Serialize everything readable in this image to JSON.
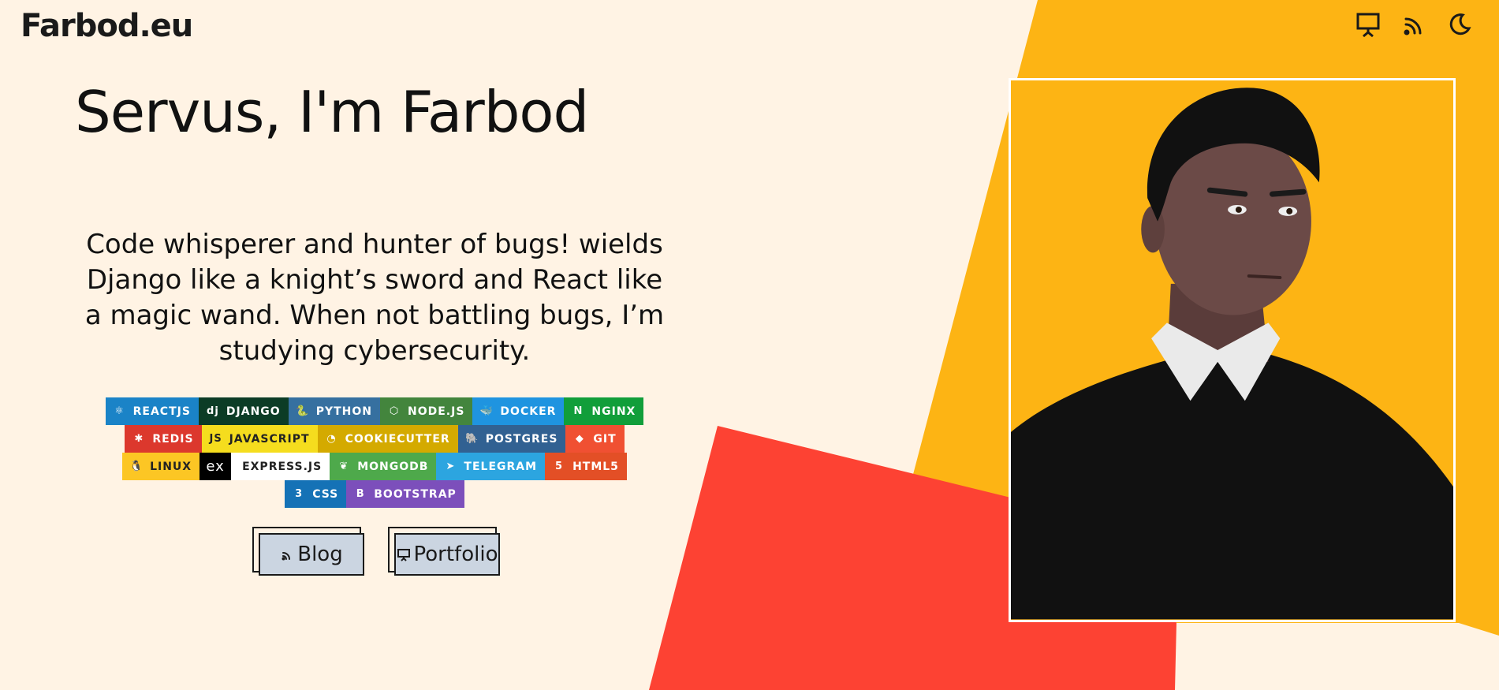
{
  "site": {
    "logo": "Farbod.eu"
  },
  "header_icons": [
    {
      "name": "presentation-icon"
    },
    {
      "name": "rss-icon"
    },
    {
      "name": "moon-icon"
    }
  ],
  "hero": {
    "title": "Servus, I'm Farbod",
    "bio": "Code whisperer and hunter of bugs! wields Django like a knight’s sword and React like a magic wand. When not battling bugs, I’m studying cybersecurity."
  },
  "badges": [
    [
      {
        "label": "REACTJS",
        "bg": "#1a83c7",
        "icon": "⚛"
      },
      {
        "label": "DJANGO",
        "bg": "#0c3c26",
        "icon": "dj"
      },
      {
        "label": "PYTHON",
        "bg": "#3670a0",
        "icon": "🐍"
      },
      {
        "label": "NODE.JS",
        "bg": "#43853d",
        "icon": "⬡"
      },
      {
        "label": "DOCKER",
        "bg": "#1f94e0",
        "icon": "🐳"
      },
      {
        "label": "NGINX",
        "bg": "#119e3a",
        "icon": "N"
      }
    ],
    [
      {
        "label": "REDIS",
        "bg": "#dc382d",
        "icon": "✱"
      },
      {
        "label": "JAVASCRIPT",
        "bg": "#f5dd1e",
        "icon": "JS",
        "dark": true
      },
      {
        "label": "COOKIECUTTER",
        "bg": "#d4aa00",
        "icon": "◔"
      },
      {
        "label": "POSTGRES",
        "bg": "#316192",
        "icon": "🐘"
      },
      {
        "label": "GIT",
        "bg": "#f05032",
        "icon": "◆"
      }
    ],
    [
      {
        "label": "LINUX",
        "bg": "#fcc624",
        "icon": "🐧",
        "dark": true
      },
      {
        "label": "EXPRESS.JS",
        "bg": "#ffffff",
        "icon": "ex",
        "dark": true,
        "iconBg": "#000000"
      },
      {
        "label": "MONGODB",
        "bg": "#4ea94b",
        "icon": "❦"
      },
      {
        "label": "TELEGRAM",
        "bg": "#2ca5e0",
        "icon": "➤"
      },
      {
        "label": "HTML5",
        "bg": "#e34f26",
        "icon": "5"
      }
    ],
    [
      {
        "label": "CSS",
        "bg": "#1572b6",
        "icon": "3"
      },
      {
        "label": "BOOTSTRAP",
        "bg": "#7c4fbb",
        "icon": "B"
      }
    ]
  ],
  "buttons": {
    "blog": "Blog",
    "portfolio": "Portfolio"
  },
  "colors": {
    "background": "#fff3e4",
    "yellow": "#fdb414",
    "red": "#fd4233",
    "button": "#cbd5e1"
  }
}
